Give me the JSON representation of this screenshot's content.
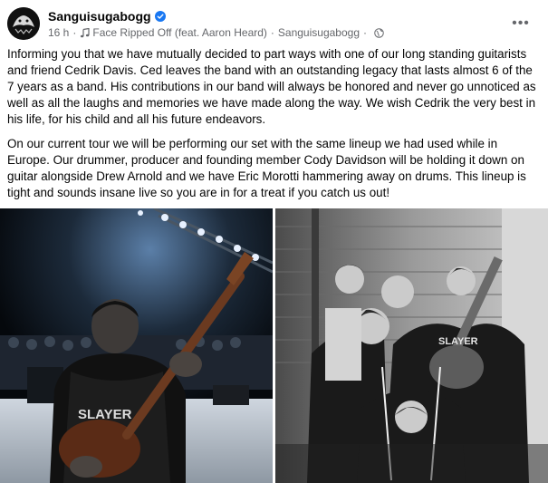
{
  "header": {
    "page_name": "Sanguisugabogg",
    "time": "16 h",
    "song": "Face Ripped Off (feat. Aaron Heard)",
    "artist": "Sanguisugabogg",
    "dot": "·",
    "more_label": "•••"
  },
  "post": {
    "paragraph1": "Informing you that we have mutually decided to part ways with one of our long standing guitarists and friend Cedrik Davis. Ced leaves the band with an outstanding legacy that lasts almost 6 of the 7 years as a band. His contributions in our band will always be honored and never go unnoticed as well as all the laughs and memories we have made along the way. We wish Cedrik the very best in his life, for his child and all his future endeavors.",
    "paragraph2": "On our current tour we will be performing our set with the same lineup we had used while in Europe. Our drummer, producer and founding member Cody Davidson will be holding it down on guitar alongside Drew Arnold and we have Eric Morotti hammering away on drums. This lineup is tight and sounds insane live so you are in for a treat if you catch us out!"
  },
  "photos": {
    "left_shirt_text": "SLAYER",
    "right_shirt_text": "SLAYER"
  },
  "colors": {
    "verified": "#1877f2",
    "meta": "#65676b",
    "text": "#050505"
  },
  "icons": {
    "verified": "verified-badge-icon",
    "music": "music-note-icon",
    "audience": "globe-icon",
    "more": "more-dots-icon"
  }
}
